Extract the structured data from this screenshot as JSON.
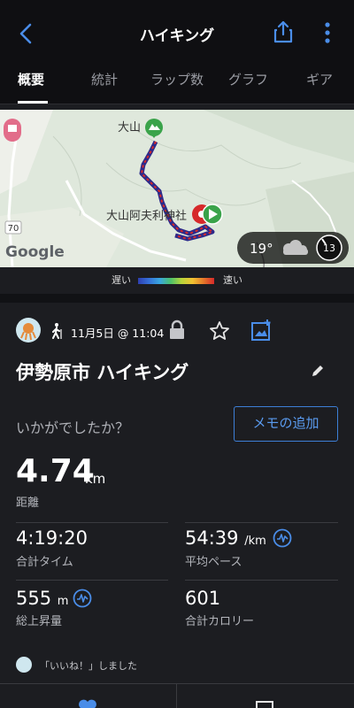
{
  "header": {
    "title": "ハイキング"
  },
  "tabs": [
    {
      "label": "概要"
    },
    {
      "label": "統計"
    },
    {
      "label": "ラップ数"
    },
    {
      "label": "グラフ"
    },
    {
      "label": "ギア"
    }
  ],
  "map": {
    "peak_label": "大山",
    "shrine_label": "大山阿夫利神社",
    "road_number": "70",
    "google_label": "Google",
    "weather_temp": "19°",
    "wind_value": "13"
  },
  "legend": {
    "slow": "遅い",
    "fast": "速い"
  },
  "activity": {
    "date": "11月5日 @ 11:04",
    "title": "伊勢原市 ハイキング",
    "prompt": "いかがでしたか？",
    "memo_button": "メモの追加"
  },
  "distance": {
    "value": "4.74",
    "unit": "km",
    "label": "距離"
  },
  "stats": {
    "time": {
      "value": "4:19:20",
      "label": "合計タイム"
    },
    "pace": {
      "value": "54:39",
      "unit": "/km",
      "label": "平均ペース"
    },
    "ascent": {
      "value": "555",
      "unit": "m",
      "label": "総上昇量"
    },
    "calories": {
      "value": "601",
      "label": "合計カロリー"
    }
  },
  "social": {
    "like_text": "「いいね！」しました"
  },
  "colors": {
    "accent": "#3d7fd6",
    "background": "#1c1d21",
    "route": "#d6292a"
  }
}
